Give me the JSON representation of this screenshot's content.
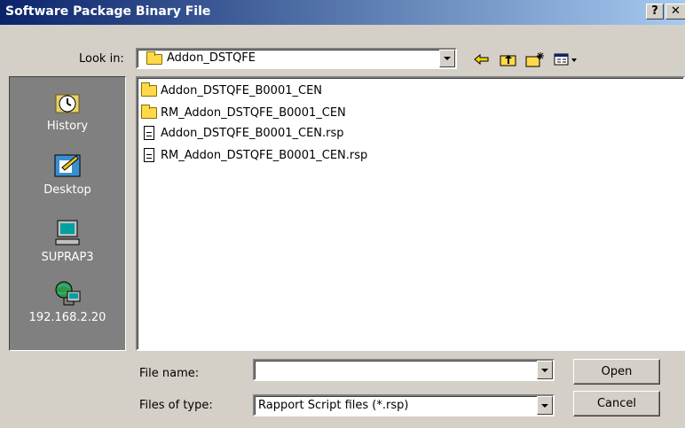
{
  "window": {
    "title": "Software Package Binary File",
    "help_label": "?",
    "close_label": "✕"
  },
  "lookin": {
    "label": "Look in:",
    "value": "Addon_DSTQFE"
  },
  "toolbar": {
    "back_icon": "back-arrow-icon",
    "up_icon": "up-one-level-icon",
    "new_folder_icon": "create-new-folder-icon",
    "view_icon": "view-menu-icon"
  },
  "places": [
    {
      "label": "History",
      "icon": "history-icon"
    },
    {
      "label": "Desktop",
      "icon": "desktop-icon"
    },
    {
      "label": "SUPRAP3",
      "icon": "computer-icon"
    },
    {
      "label": "192.168.2.20",
      "icon": "network-icon"
    }
  ],
  "files": [
    {
      "name": "Addon_DSTQFE_B0001_CEN",
      "type": "folder"
    },
    {
      "name": "RM_Addon_DSTQFE_B0001_CEN",
      "type": "folder"
    },
    {
      "name": "Addon_DSTQFE_B0001_CEN.rsp",
      "type": "file"
    },
    {
      "name": "RM_Addon_DSTQFE_B0001_CEN.rsp",
      "type": "file"
    }
  ],
  "filename": {
    "label": "File name:",
    "value": ""
  },
  "filetype": {
    "label": "Files of type:",
    "value": "Rapport Script files (*.rsp)"
  },
  "buttons": {
    "open": "Open",
    "cancel": "Cancel"
  },
  "colors": {
    "titlebar_start": "#0a246a",
    "titlebar_end": "#a6caf0",
    "face": "#d4d0c8",
    "places_bg": "#808080"
  }
}
